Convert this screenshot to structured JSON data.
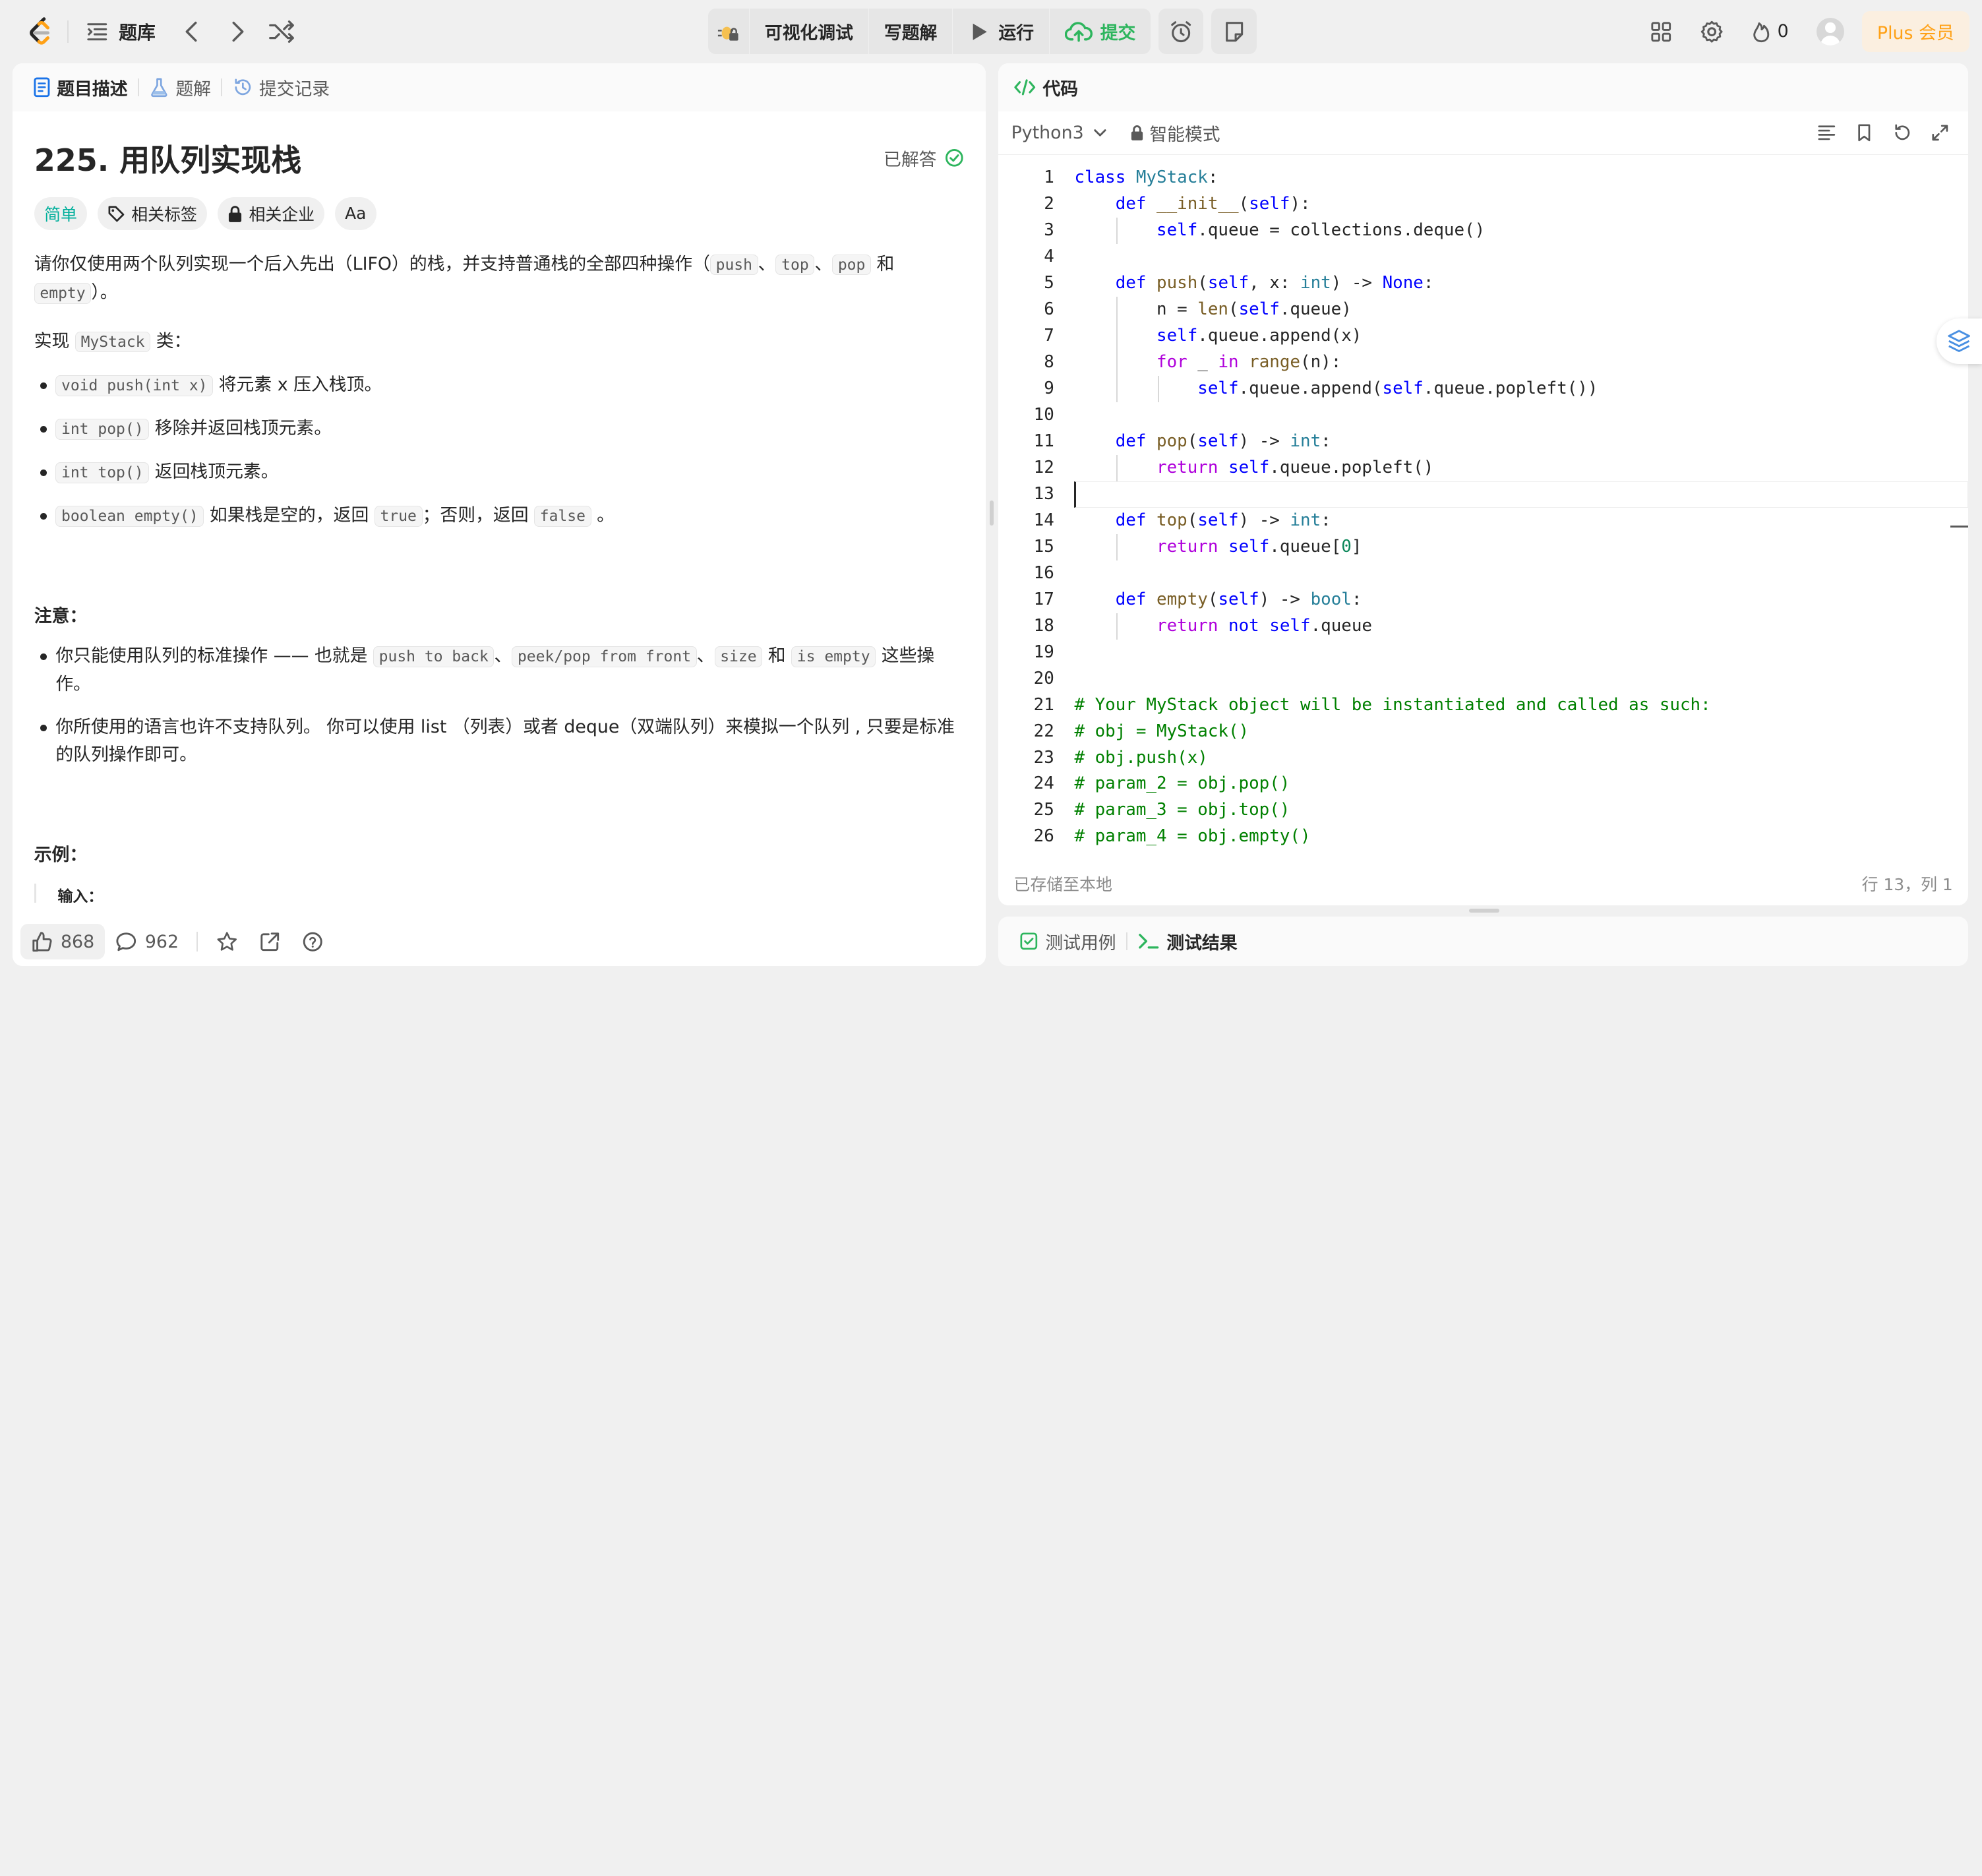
{
  "topbar": {
    "tiku_label": "题库",
    "center": {
      "visual_debug": "可视化调试",
      "write_solution": "写题解",
      "run": "运行",
      "submit": "提交"
    },
    "streak_count": "0",
    "plus_label": "Plus 会员"
  },
  "left": {
    "tabs": [
      "题目描述",
      "题解",
      "提交记录"
    ],
    "title": "225. 用队列实现栈",
    "solved_label": "已解答",
    "tags": [
      "简单",
      "相关标签",
      "相关企业",
      "Aa"
    ],
    "intro": {
      "a": "请你仅使用两个队列实现一个后入先出（LIFO）的栈，并支持普通栈的全部四种操作（",
      "c1": "push",
      "sep1": "、",
      "c2": "top",
      "sep2": "、",
      "c3": "pop",
      "sep3": " 和 ",
      "c4": "empty",
      "b": "）。"
    },
    "impl": {
      "a": "实现 ",
      "code": "MyStack",
      "b": " 类："
    },
    "methods": [
      {
        "code": "void push(int x)",
        "text": " 将元素 x 压入栈顶。"
      },
      {
        "code": "int pop()",
        "text": " 移除并返回栈顶元素。"
      },
      {
        "code": "int top()",
        "text": " 返回栈顶元素。"
      }
    ],
    "method_empty": {
      "code": "boolean empty()",
      "a": " 如果栈是空的，返回 ",
      "c_true": "true",
      "b": "；否则，返回 ",
      "c_false": "false",
      "c": " 。"
    },
    "note_title": "注意：",
    "note1": {
      "a": "你只能使用队列的标准操作 —— 也就是 ",
      "c1": "push to back",
      "s1": "、",
      "c2": "peek/pop from front",
      "s2": "、",
      "c3": "size",
      "s3": " 和 ",
      "c4": "is empty",
      "b": " 这些操作。"
    },
    "note2": "你所使用的语言也许不支持队列。 你可以使用 list （列表）或者 deque（双端队列）来模拟一个队列 , 只要是标准的队列操作即可。",
    "example_title": "示例：",
    "example_input": "输入：",
    "footer": {
      "likes": "868",
      "comments": "962"
    }
  },
  "code": {
    "header": "代码",
    "language": "Python3",
    "mode": "智能模式",
    "status_saved": "已存储至本地",
    "status_pos": "行 13，列 1",
    "current_line": 13
  },
  "test": {
    "tab_cases": "测试用例",
    "tab_result": "测试结果"
  },
  "colors": {
    "accent_orange": "#ffa116",
    "submit_green": "#2db55d",
    "easy_teal": "#00af9b",
    "keyword": "#0000ff",
    "comment": "#008000"
  }
}
